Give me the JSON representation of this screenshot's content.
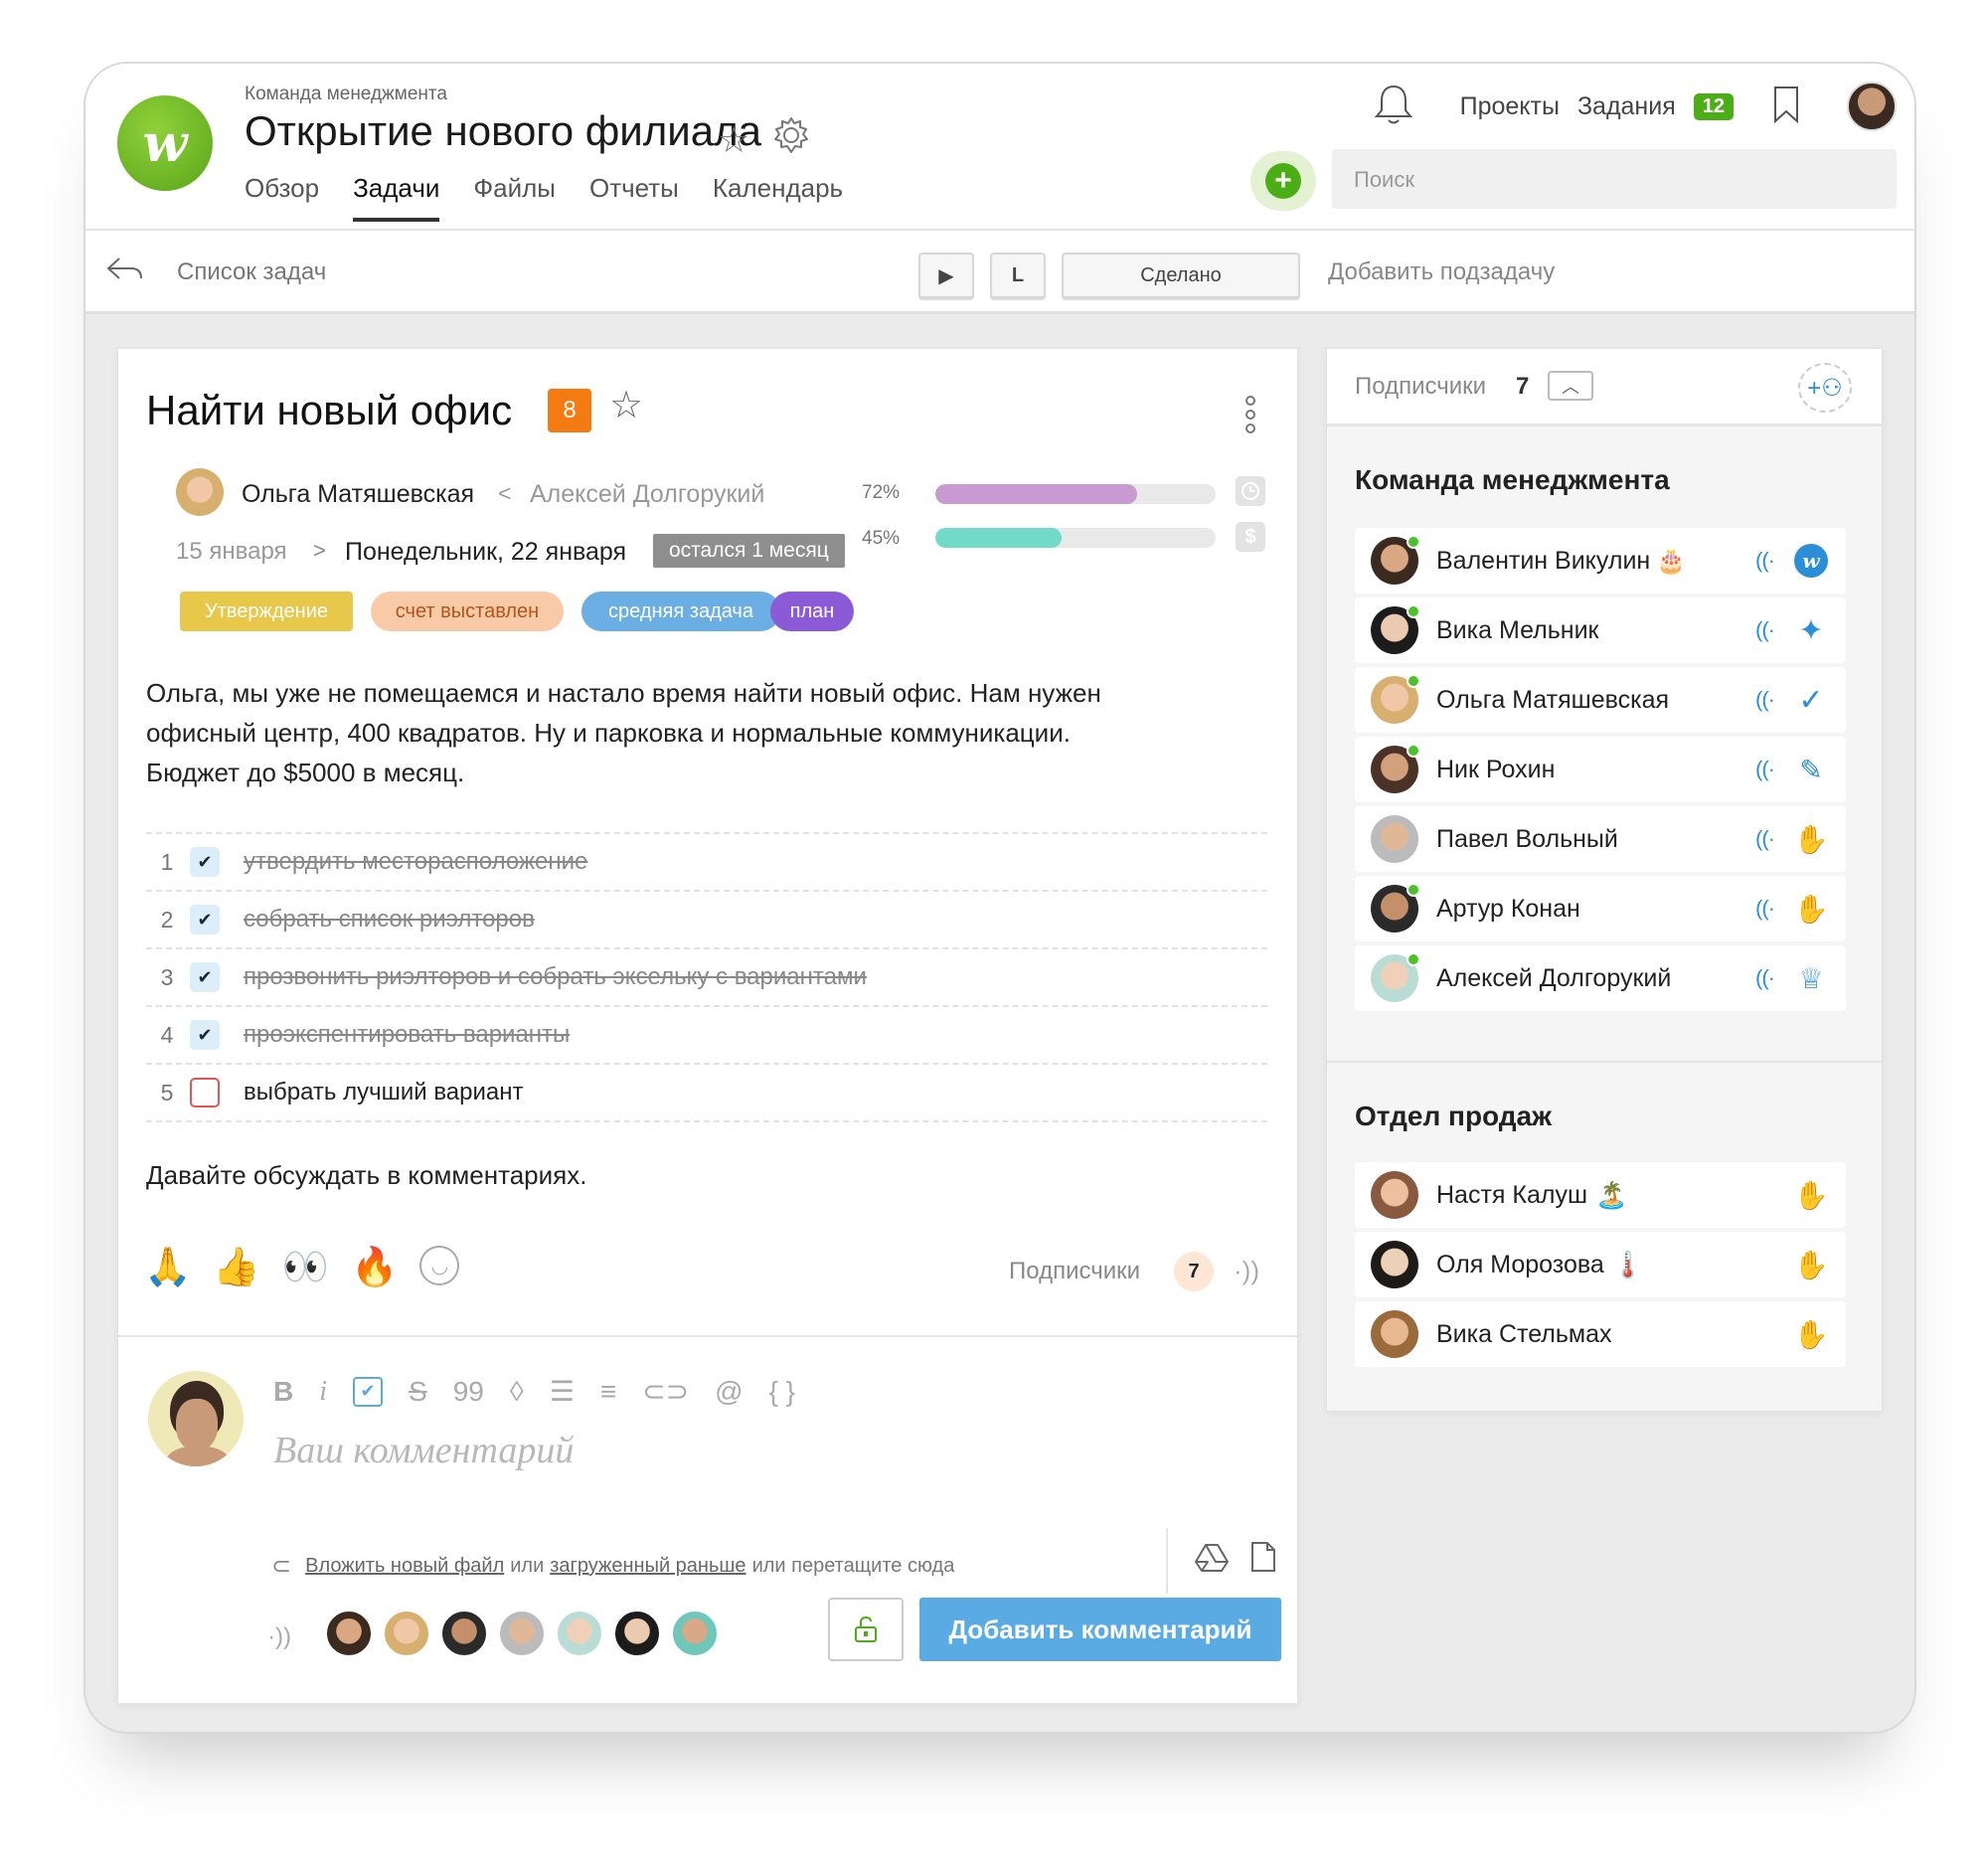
{
  "header": {
    "breadcrumb": "Команда менеджмента",
    "title": "Открытие нового филиала",
    "logo_letter": "w",
    "tabs": [
      "Обзор",
      "Задачи",
      "Файлы",
      "Отчеты",
      "Календарь"
    ],
    "active_tab": "Задачи",
    "nav": {
      "projects": "Проекты",
      "tasks": "Задания",
      "tasks_count": "12"
    },
    "search_placeholder": "Поиск"
  },
  "toolbar": {
    "back_label": "Список задач",
    "play_label": "▶",
    "l_label": "L",
    "done_label": "Сделано",
    "add_subtask": "Добавить подзадачу"
  },
  "task": {
    "title": "Найти новый офис",
    "priority": "8",
    "assignee": "Ольга Матяшевская",
    "separator": "<",
    "assigner": "Алексей Долгорукий",
    "date_from": "15 января",
    "date_arrow": ">",
    "date_to": "Понедельник, 22 января",
    "remaining": "остался 1 месяц",
    "progress": [
      {
        "label": "72%",
        "value": 0.72,
        "color": "#c99ad1",
        "icon": "clock-icon"
      },
      {
        "label": "45%",
        "value": 0.45,
        "color": "#72dac8",
        "icon": "dollar-icon"
      }
    ],
    "tags": [
      {
        "label": "Утверждение",
        "bg": "#e8c84a",
        "fg": "#ffffff"
      },
      {
        "label": "счет выставлен",
        "bg": "#f9caa7",
        "fg": "#b2561a"
      },
      {
        "label": "средняя задача",
        "bg": "#6aaee3",
        "fg": "#ffffff"
      },
      {
        "label": "план",
        "bg": "#8b5ad6",
        "fg": "#ffffff"
      }
    ],
    "description": [
      "Ольга, мы уже не помещаемся и настало время найти новый офис. Нам нужен",
      "офисный центр, 400 квадратов. Ну и парковка и нормальные коммуникации.",
      "Бюджет до $5000 в месяц."
    ],
    "checklist": [
      {
        "n": "1",
        "text": "утвердить месторасположение",
        "done": true
      },
      {
        "n": "2",
        "text": "собрать список риэлторов",
        "done": true
      },
      {
        "n": "3",
        "text": "прозвонить риэлторов и собрать эксельку с вариантами",
        "done": true
      },
      {
        "n": "4",
        "text": "проэкспентировать варианты",
        "done": true
      },
      {
        "n": "5",
        "text": "выбрать лучший вариант",
        "done": false
      }
    ],
    "footer_note": "Давайте обсуждать в комментариях.",
    "reactions": [
      "🙏",
      "👍",
      "👀",
      "🔥"
    ],
    "subscribers_label": "Подписчики",
    "subscribers_count": "7"
  },
  "comment": {
    "placeholder": "Ваш комментарий",
    "attach_link1": "Вложить новый файл",
    "attach_or1": "или",
    "attach_link2": "загруженный раньше",
    "attach_rest": "или перетащите сюда",
    "submit": "Добавить комментарий",
    "format_tools": [
      "bold-icon",
      "italic-icon",
      "checkbox-icon",
      "strikethrough-icon",
      "quote-icon",
      "color-drop-icon",
      "bullet-list-icon",
      "numbered-list-icon",
      "link-icon",
      "mention-icon",
      "code-icon"
    ]
  },
  "sidebar": {
    "subscribers_label": "Подписчики",
    "subscribers_count": "7",
    "groups": [
      {
        "title": "Команда менеджмента",
        "members": [
          {
            "name": "Валентин Викулин",
            "emoji": "🎂",
            "role_icon": "app-logo-icon"
          },
          {
            "name": "Вика Мельник",
            "emoji": "",
            "role_icon": "sparkle-icon"
          },
          {
            "name": "Ольга Матяшевская",
            "emoji": "",
            "role_icon": "check-icon"
          },
          {
            "name": "Ник Рохин",
            "emoji": "",
            "role_icon": "pen-icon"
          },
          {
            "name": "Павел Вольный",
            "emoji": "",
            "role_icon": "hand-icon"
          },
          {
            "name": "Артур Конан",
            "emoji": "",
            "role_icon": "hand-icon"
          },
          {
            "name": "Алексей Долгорукий",
            "emoji": "",
            "role_icon": "crown-icon"
          }
        ]
      },
      {
        "title": "Отдел продаж",
        "members": [
          {
            "name": "Настя Калуш",
            "emoji": "🏝️",
            "role_icon": "hand-icon"
          },
          {
            "name": "Оля Морозова",
            "emoji": "🌡️",
            "role_icon": "hand-icon"
          },
          {
            "name": "Вика Стельмах",
            "emoji": "",
            "role_icon": "hand-icon"
          }
        ]
      }
    ]
  },
  "colors": {
    "accent_green": "#4cae17",
    "accent_blue": "#5aabe3",
    "priority_orange": "#f47a12"
  }
}
